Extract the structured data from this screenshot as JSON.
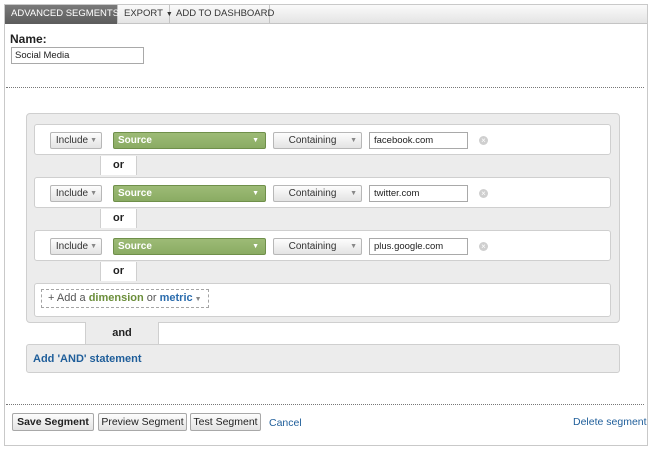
{
  "toolbar": {
    "advanced_segments": "ADVANCED SEGMENTS",
    "export": "EXPORT",
    "add_to_dashboard": "ADD TO DASHBOARD"
  },
  "segment": {
    "name_label": "Name:",
    "name_value": "Social Media"
  },
  "conditions": [
    {
      "include": "Include",
      "dimension": "Source",
      "operator": "Containing",
      "value": "facebook.com"
    },
    {
      "include": "Include",
      "dimension": "Source",
      "operator": "Containing",
      "value": "twitter.com"
    },
    {
      "include": "Include",
      "dimension": "Source",
      "operator": "Containing",
      "value": "plus.google.com"
    }
  ],
  "or_label": "or",
  "add_filter": {
    "prefix": "+ Add a",
    "dimension": "dimension",
    "or": "or",
    "metric": "metric"
  },
  "and_label": "and",
  "add_and_statement": "Add 'AND' statement",
  "actions": {
    "save": "Save Segment",
    "preview": "Preview Segment",
    "test": "Test Segment",
    "cancel": "Cancel",
    "delete": "Delete segment"
  },
  "icons": {
    "dropdown": "chevron-down-icon",
    "remove": "remove-circle-icon"
  }
}
